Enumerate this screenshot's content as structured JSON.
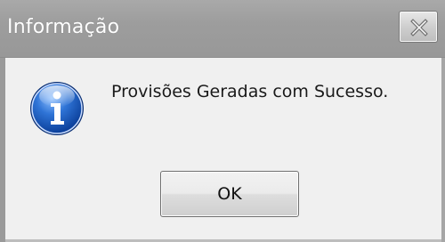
{
  "window": {
    "title": "Informação"
  },
  "titlebar": {
    "close_icon": "close-icon"
  },
  "message": {
    "icon": "info-icon",
    "text": "Provisões Geradas com Sucesso."
  },
  "buttons": {
    "ok_label": "OK"
  },
  "colors": {
    "titlebar": "#9d9d9d",
    "title_text": "#ffffff",
    "body_background": "#f0f0f0",
    "icon_blue": "#1f5fbf"
  }
}
